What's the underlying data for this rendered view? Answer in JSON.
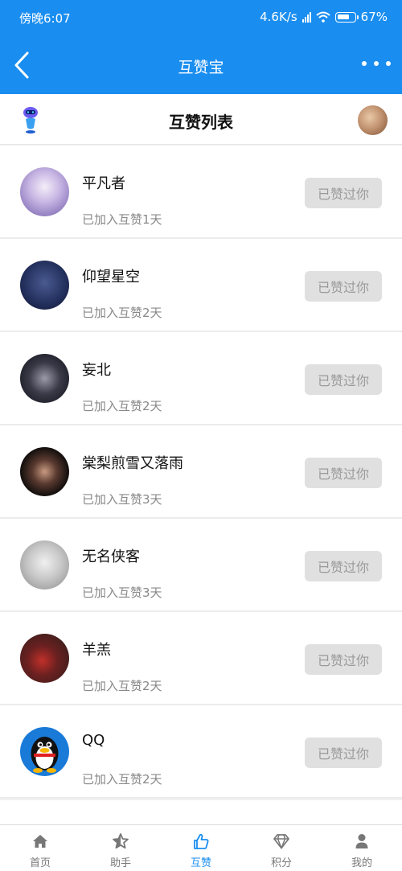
{
  "status_bar": {
    "time": "傍晚6:07",
    "net_speed": "4.6K/s",
    "battery": "67%"
  },
  "header": {
    "title": "互赞宝"
  },
  "sub_header": {
    "title": "互赞列表"
  },
  "list": {
    "items": [
      {
        "name": "平凡者",
        "joined": "已加入互赞1天",
        "button": "已赞过你",
        "avatar_color": "#b3a6d8"
      },
      {
        "name": "仰望星空",
        "joined": "已加入互赞2天",
        "button": "已赞过你",
        "avatar_color": "#2a3560"
      },
      {
        "name": "妄北",
        "joined": "已加入互赞2天",
        "button": "已赞过你",
        "avatar_color": "#2a2a32"
      },
      {
        "name": "棠梨煎雪又落雨",
        "joined": "已加入互赞3天",
        "button": "已赞过你",
        "avatar_color": "#1a1a1a"
      },
      {
        "name": "无名侠客",
        "joined": "已加入互赞3天",
        "button": "已赞过你",
        "avatar_color": "#cfcfcf"
      },
      {
        "name": "羊羔",
        "joined": "已加入互赞2天",
        "button": "已赞过你",
        "avatar_color": "#6a2a2a"
      },
      {
        "name": "QQ",
        "joined": "已加入互赞2天",
        "button": "已赞过你",
        "avatar_color": "#1a7ad8"
      }
    ]
  },
  "tabs": [
    {
      "label": "首页",
      "icon": "home-icon",
      "active": false
    },
    {
      "label": "助手",
      "icon": "star-icon",
      "active": false
    },
    {
      "label": "互赞",
      "icon": "thumbs-up-icon",
      "active": true
    },
    {
      "label": "积分",
      "icon": "diamond-icon",
      "active": false
    },
    {
      "label": "我的",
      "icon": "person-icon",
      "active": false
    }
  ],
  "colors": {
    "brand": "#1a8ef0",
    "button_bg": "#e0e0e0",
    "button_text": "#9a9a9a"
  }
}
